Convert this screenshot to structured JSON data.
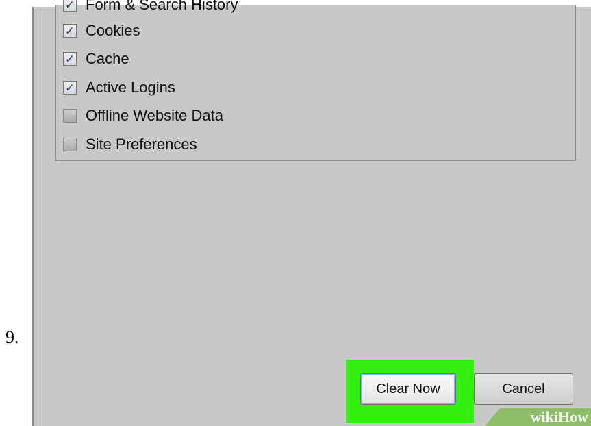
{
  "step": {
    "number": "9."
  },
  "dialog": {
    "checkboxes": [
      {
        "label": "Form & Search History",
        "checked": true
      },
      {
        "label": "Cookies",
        "checked": true
      },
      {
        "label": "Cache",
        "checked": true
      },
      {
        "label": "Active Logins",
        "checked": true
      },
      {
        "label": "Offline Website Data",
        "checked": false
      },
      {
        "label": "Site Preferences",
        "checked": false
      }
    ],
    "buttons": {
      "clear_now": "Clear Now",
      "cancel": "Cancel"
    },
    "highlight_color": "#33ee11"
  },
  "watermark": {
    "wiki": "wiki",
    "how": "How"
  }
}
